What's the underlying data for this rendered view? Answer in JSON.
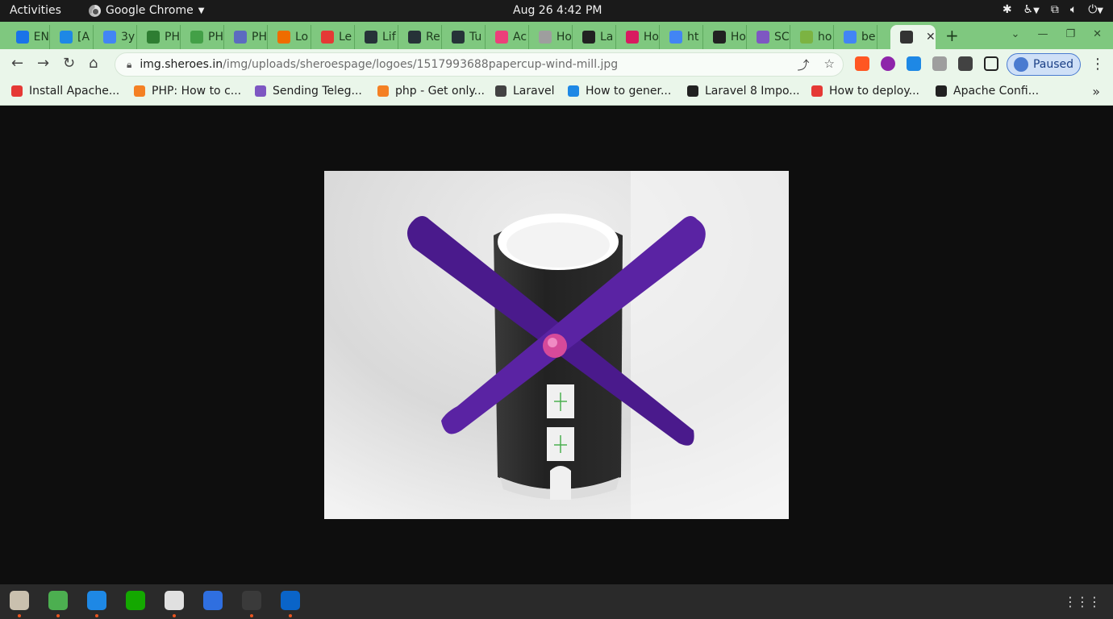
{
  "topbar": {
    "activities": "Activities",
    "app_name": "Google Chrome",
    "datetime": "Aug 26  4:42 PM"
  },
  "tabs": [
    {
      "label": "EN",
      "color": "#1a73e8"
    },
    {
      "label": "[A",
      "color": "#1e88e5"
    },
    {
      "label": "3y",
      "color": "#4285f4"
    },
    {
      "label": "PH",
      "color": "#2e7d32"
    },
    {
      "label": "PH",
      "color": "#43a047"
    },
    {
      "label": "PH",
      "color": "#5c6bc0"
    },
    {
      "label": "Lo",
      "color": "#ef6c00"
    },
    {
      "label": "Le",
      "color": "#e53935"
    },
    {
      "label": "Lif",
      "color": "#263238"
    },
    {
      "label": "Re",
      "color": "#263238"
    },
    {
      "label": "Tu",
      "color": "#263238"
    },
    {
      "label": "Ac",
      "color": "#ec407a"
    },
    {
      "label": "Ho",
      "color": "#9e9e9e"
    },
    {
      "label": "La",
      "color": "#212121"
    },
    {
      "label": "Ho",
      "color": "#d81b60"
    },
    {
      "label": "ht",
      "color": "#4285f4"
    },
    {
      "label": "Ho",
      "color": "#212121"
    },
    {
      "label": "SC",
      "color": "#7e57c2"
    },
    {
      "label": "ho",
      "color": "#7cb342"
    },
    {
      "label": "be",
      "color": "#4285f4"
    },
    {
      "label": "",
      "color": "#333333"
    }
  ],
  "address_bar": {
    "host": "img.sheroes.in",
    "path": "/img/uploads/sheroespage/logoes/1517993688papercup-wind-mill.jpg"
  },
  "profile": {
    "label": "Paused"
  },
  "bookmarks": [
    {
      "label": "Install Apache...",
      "color": "#e53935"
    },
    {
      "label": "PHP: How to c...",
      "color": "#f48024"
    },
    {
      "label": "Sending Teleg...",
      "color": "#7e57c2"
    },
    {
      "label": "php - Get only...",
      "color": "#f48024"
    },
    {
      "label": "Laravel",
      "color": "#424242"
    },
    {
      "label": "How to gener...",
      "color": "#1e88e5"
    },
    {
      "label": "Laravel 8 Impo...",
      "color": "#212121"
    },
    {
      "label": "How to deploy...",
      "color": "#e53935"
    },
    {
      "label": "Apache Confi...",
      "color": "#212121"
    }
  ],
  "dock": [
    {
      "name": "files",
      "color": "#c9c0ae"
    },
    {
      "name": "chrome",
      "color": "#4caf50"
    },
    {
      "name": "vscode",
      "color": "#1e88e5"
    },
    {
      "name": "upwork",
      "color": "#14a800"
    },
    {
      "name": "slack",
      "color": "#e0e0e0"
    },
    {
      "name": "anydesk",
      "color": "#2f6fe0"
    },
    {
      "name": "terminal",
      "color": "#3a3a3a"
    },
    {
      "name": "outlook",
      "color": "#0a64c8"
    }
  ]
}
